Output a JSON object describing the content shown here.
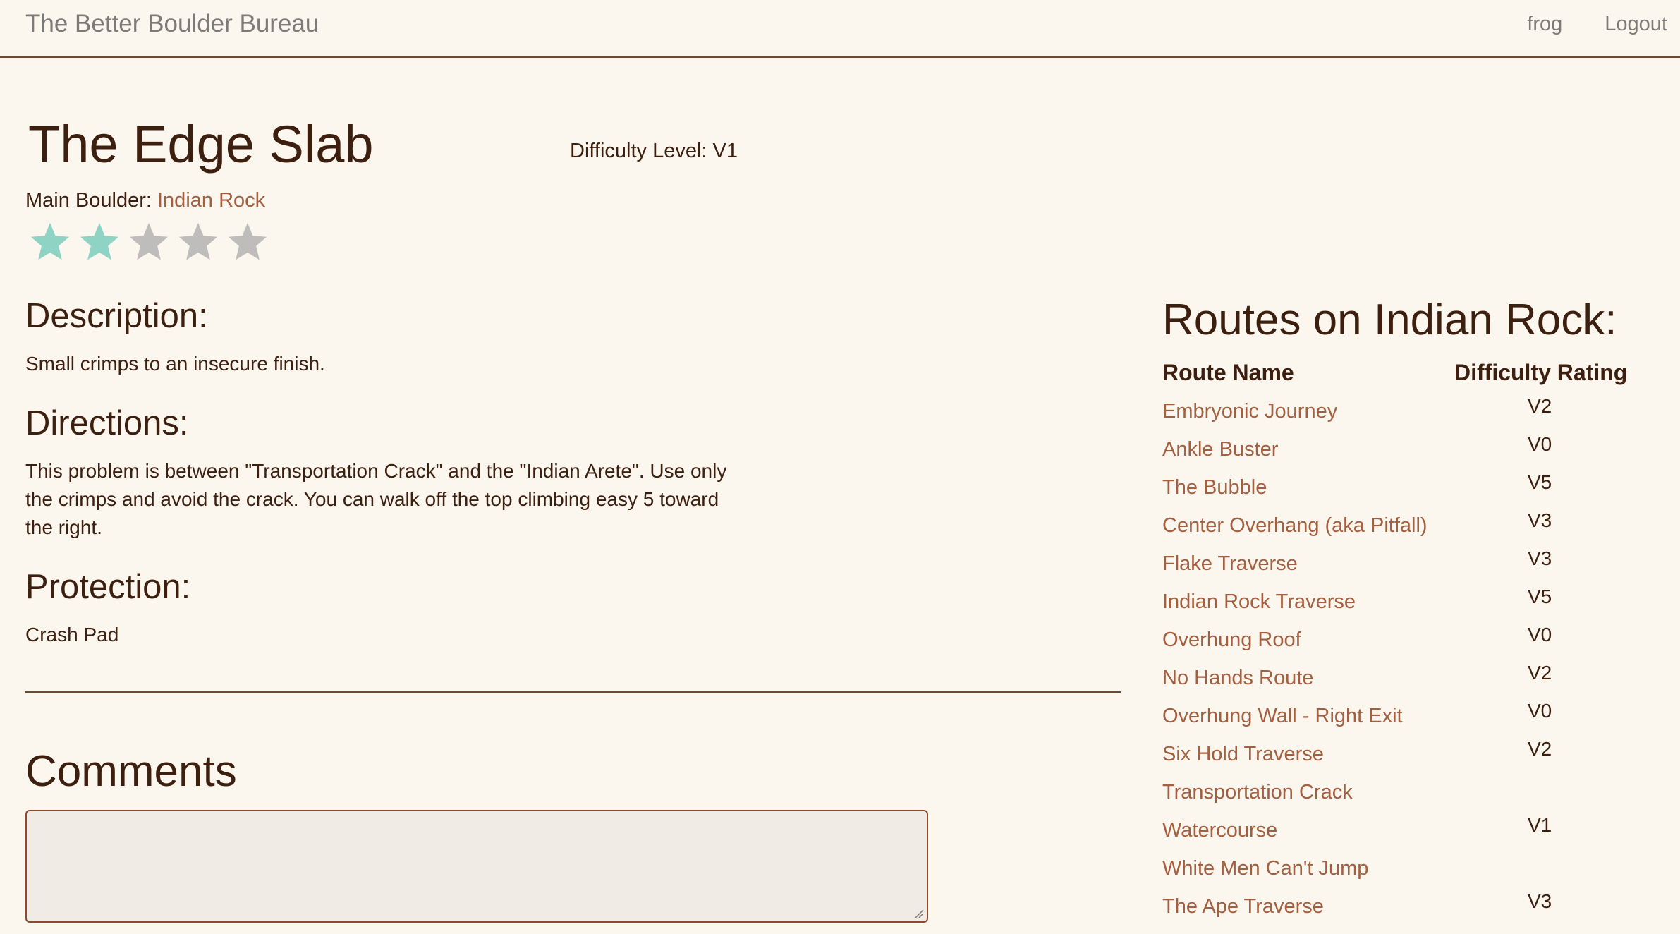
{
  "navbar": {
    "brand": "The Better Boulder Bureau",
    "user": "frog",
    "logout": "Logout"
  },
  "route": {
    "title": "The Edge Slab",
    "difficulty_label": "Difficulty Level: V1",
    "main_boulder_label": "Main Boulder: ",
    "main_boulder": "Indian Rock",
    "rating": {
      "value": 2,
      "max": 5
    },
    "description_heading": "Description:",
    "description": "Small crimps to an insecure finish.",
    "directions_heading": "Directions:",
    "directions_line1": "This problem is between \"Transportation Crack\" and the \"Indian Arete\". Use only",
    "directions_line2": "the crimps and avoid the crack. You can walk off the top climbing easy 5 toward",
    "directions_line3": "the right.",
    "protection_heading": "Protection:",
    "protection": "Crash Pad"
  },
  "comments": {
    "heading": "Comments",
    "input_value": ""
  },
  "routes_panel": {
    "heading": "Routes on Indian Rock:",
    "columns": [
      "Route Name",
      "Difficulty Rating"
    ],
    "rows": [
      {
        "name": "Embryonic Journey",
        "difficulty": "V2"
      },
      {
        "name": "Ankle Buster",
        "difficulty": "V0"
      },
      {
        "name": "The Bubble",
        "difficulty": "V5"
      },
      {
        "name": "Center Overhang (aka Pitfall)",
        "difficulty": "V3"
      },
      {
        "name": "Flake Traverse",
        "difficulty": "V3"
      },
      {
        "name": "Indian Rock Traverse",
        "difficulty": "V5"
      },
      {
        "name": "Overhung Roof",
        "difficulty": "V0"
      },
      {
        "name": "No Hands Route",
        "difficulty": "V2"
      },
      {
        "name": "Overhung Wall - Right Exit",
        "difficulty": "V0"
      },
      {
        "name": "Six Hold Traverse",
        "difficulty": "V2"
      },
      {
        "name": "Transportation Crack",
        "difficulty": ""
      },
      {
        "name": "Watercourse",
        "difficulty": "V1"
      },
      {
        "name": "White Men Can't Jump",
        "difficulty": ""
      },
      {
        "name": "The Ape Traverse",
        "difficulty": "V3"
      }
    ]
  },
  "colors": {
    "star_filled": "#8fd3c4",
    "star_empty": "#bfbdbc",
    "link": "#a35f3f",
    "text": "#3d1f0f",
    "background": "#fbf6ee"
  }
}
